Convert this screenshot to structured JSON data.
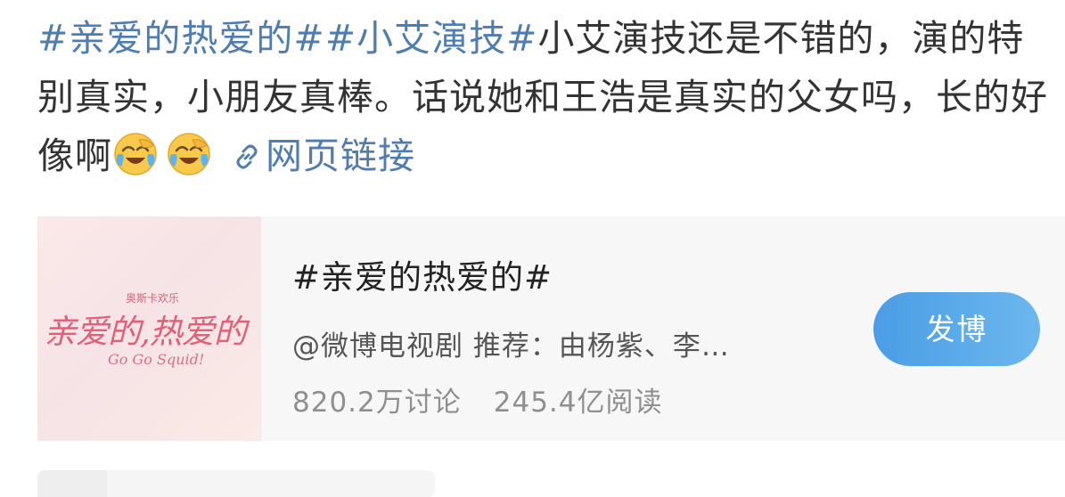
{
  "post": {
    "tag1": "#亲爱的热爱的#",
    "tag2": "#小艾演技#",
    "body": "小艾演技还是不错的，演的特别真实，小朋友真棒。话说她和王浩是真实的父女吗，长的好像啊",
    "emojis": [
      "laugh-cry-emoji",
      "laugh-cry-emoji"
    ],
    "link_label": "网页链接",
    "link_icon": "link-icon"
  },
  "topic_card": {
    "cover": {
      "small_text": "奥斯卡欢乐",
      "title_text": "亲爱的,热爱的",
      "subtitle_en": "Go Go Squid!"
    },
    "title": "#亲爱的热爱的#",
    "subtitle": "@微博电视剧 推荐：由杨紫、李…",
    "discussions": "820.2万讨论",
    "reads": "245.4亿阅读",
    "button_label": "发博",
    "colors": {
      "tag": "#507daf",
      "button_start": "#4a9de5",
      "button_end": "#6cb7ee",
      "card_bg": "#f7f7f7"
    }
  }
}
